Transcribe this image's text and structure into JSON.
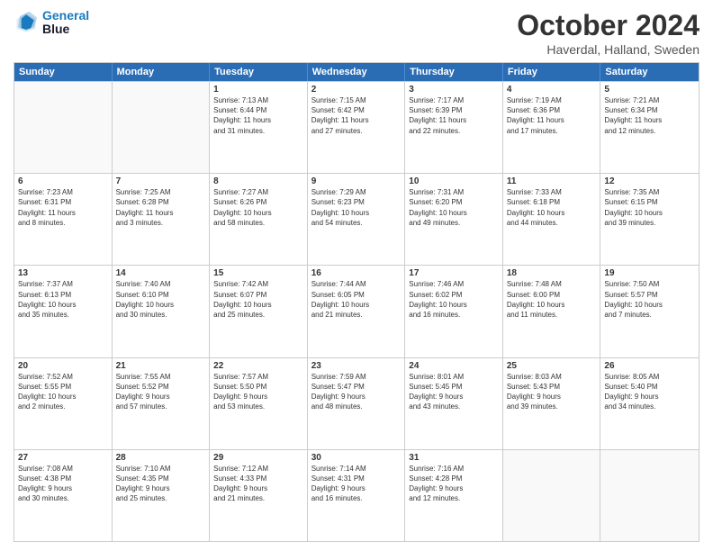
{
  "logo": {
    "line1": "General",
    "line2": "Blue"
  },
  "title": "October 2024",
  "subtitle": "Haverdal, Halland, Sweden",
  "header_days": [
    "Sunday",
    "Monday",
    "Tuesday",
    "Wednesday",
    "Thursday",
    "Friday",
    "Saturday"
  ],
  "rows": [
    [
      {
        "day": "",
        "text": ""
      },
      {
        "day": "",
        "text": ""
      },
      {
        "day": "1",
        "text": "Sunrise: 7:13 AM\nSunset: 6:44 PM\nDaylight: 11 hours\nand 31 minutes."
      },
      {
        "day": "2",
        "text": "Sunrise: 7:15 AM\nSunset: 6:42 PM\nDaylight: 11 hours\nand 27 minutes."
      },
      {
        "day": "3",
        "text": "Sunrise: 7:17 AM\nSunset: 6:39 PM\nDaylight: 11 hours\nand 22 minutes."
      },
      {
        "day": "4",
        "text": "Sunrise: 7:19 AM\nSunset: 6:36 PM\nDaylight: 11 hours\nand 17 minutes."
      },
      {
        "day": "5",
        "text": "Sunrise: 7:21 AM\nSunset: 6:34 PM\nDaylight: 11 hours\nand 12 minutes."
      }
    ],
    [
      {
        "day": "6",
        "text": "Sunrise: 7:23 AM\nSunset: 6:31 PM\nDaylight: 11 hours\nand 8 minutes."
      },
      {
        "day": "7",
        "text": "Sunrise: 7:25 AM\nSunset: 6:28 PM\nDaylight: 11 hours\nand 3 minutes."
      },
      {
        "day": "8",
        "text": "Sunrise: 7:27 AM\nSunset: 6:26 PM\nDaylight: 10 hours\nand 58 minutes."
      },
      {
        "day": "9",
        "text": "Sunrise: 7:29 AM\nSunset: 6:23 PM\nDaylight: 10 hours\nand 54 minutes."
      },
      {
        "day": "10",
        "text": "Sunrise: 7:31 AM\nSunset: 6:20 PM\nDaylight: 10 hours\nand 49 minutes."
      },
      {
        "day": "11",
        "text": "Sunrise: 7:33 AM\nSunset: 6:18 PM\nDaylight: 10 hours\nand 44 minutes."
      },
      {
        "day": "12",
        "text": "Sunrise: 7:35 AM\nSunset: 6:15 PM\nDaylight: 10 hours\nand 39 minutes."
      }
    ],
    [
      {
        "day": "13",
        "text": "Sunrise: 7:37 AM\nSunset: 6:13 PM\nDaylight: 10 hours\nand 35 minutes."
      },
      {
        "day": "14",
        "text": "Sunrise: 7:40 AM\nSunset: 6:10 PM\nDaylight: 10 hours\nand 30 minutes."
      },
      {
        "day": "15",
        "text": "Sunrise: 7:42 AM\nSunset: 6:07 PM\nDaylight: 10 hours\nand 25 minutes."
      },
      {
        "day": "16",
        "text": "Sunrise: 7:44 AM\nSunset: 6:05 PM\nDaylight: 10 hours\nand 21 minutes."
      },
      {
        "day": "17",
        "text": "Sunrise: 7:46 AM\nSunset: 6:02 PM\nDaylight: 10 hours\nand 16 minutes."
      },
      {
        "day": "18",
        "text": "Sunrise: 7:48 AM\nSunset: 6:00 PM\nDaylight: 10 hours\nand 11 minutes."
      },
      {
        "day": "19",
        "text": "Sunrise: 7:50 AM\nSunset: 5:57 PM\nDaylight: 10 hours\nand 7 minutes."
      }
    ],
    [
      {
        "day": "20",
        "text": "Sunrise: 7:52 AM\nSunset: 5:55 PM\nDaylight: 10 hours\nand 2 minutes."
      },
      {
        "day": "21",
        "text": "Sunrise: 7:55 AM\nSunset: 5:52 PM\nDaylight: 9 hours\nand 57 minutes."
      },
      {
        "day": "22",
        "text": "Sunrise: 7:57 AM\nSunset: 5:50 PM\nDaylight: 9 hours\nand 53 minutes."
      },
      {
        "day": "23",
        "text": "Sunrise: 7:59 AM\nSunset: 5:47 PM\nDaylight: 9 hours\nand 48 minutes."
      },
      {
        "day": "24",
        "text": "Sunrise: 8:01 AM\nSunset: 5:45 PM\nDaylight: 9 hours\nand 43 minutes."
      },
      {
        "day": "25",
        "text": "Sunrise: 8:03 AM\nSunset: 5:43 PM\nDaylight: 9 hours\nand 39 minutes."
      },
      {
        "day": "26",
        "text": "Sunrise: 8:05 AM\nSunset: 5:40 PM\nDaylight: 9 hours\nand 34 minutes."
      }
    ],
    [
      {
        "day": "27",
        "text": "Sunrise: 7:08 AM\nSunset: 4:38 PM\nDaylight: 9 hours\nand 30 minutes."
      },
      {
        "day": "28",
        "text": "Sunrise: 7:10 AM\nSunset: 4:35 PM\nDaylight: 9 hours\nand 25 minutes."
      },
      {
        "day": "29",
        "text": "Sunrise: 7:12 AM\nSunset: 4:33 PM\nDaylight: 9 hours\nand 21 minutes."
      },
      {
        "day": "30",
        "text": "Sunrise: 7:14 AM\nSunset: 4:31 PM\nDaylight: 9 hours\nand 16 minutes."
      },
      {
        "day": "31",
        "text": "Sunrise: 7:16 AM\nSunset: 4:28 PM\nDaylight: 9 hours\nand 12 minutes."
      },
      {
        "day": "",
        "text": ""
      },
      {
        "day": "",
        "text": ""
      }
    ]
  ]
}
